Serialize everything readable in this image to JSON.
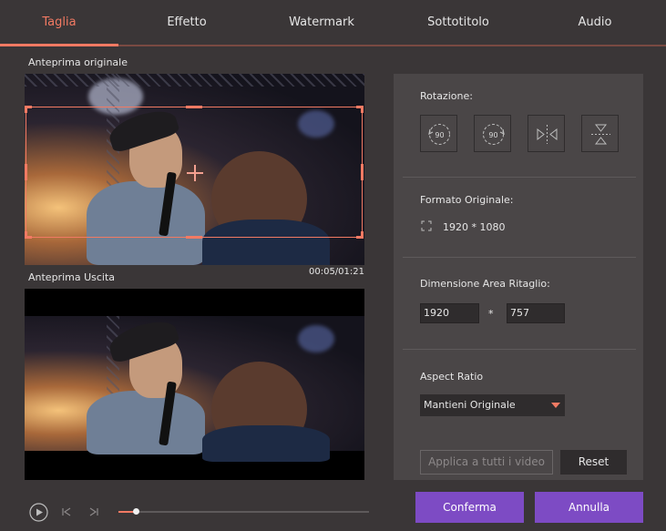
{
  "tabs": [
    {
      "label": "Taglia",
      "active": true
    },
    {
      "label": "Effetto",
      "active": false
    },
    {
      "label": "Watermark",
      "active": false
    },
    {
      "label": "Sottotitolo",
      "active": false
    },
    {
      "label": "Audio",
      "active": false
    }
  ],
  "preview": {
    "original_label": "Anteprima originale",
    "output_label": "Anteprima Uscita",
    "timecode": "00:05/01:21"
  },
  "panel": {
    "rotation_label": "Rotazione:",
    "rotate_left_text": "90",
    "rotate_right_text": "90",
    "original_format_label": "Formato Originale:",
    "original_format_value": "1920 * 1080",
    "crop_size_label": "Dimensione Area Ritaglio:",
    "crop_width": "1920",
    "crop_separator": "*",
    "crop_height": "757",
    "aspect_ratio_label": "Aspect Ratio",
    "aspect_ratio_value": "Mantieni Originale",
    "apply_all_label": "Applica a tutti i video",
    "reset_label": "Reset"
  },
  "actions": {
    "confirm_label": "Conferma",
    "cancel_label": "Annulla"
  },
  "player": {
    "progress": 0.07
  },
  "icons": {
    "rotate_left": "rotate-left-icon",
    "rotate_right": "rotate-right-icon",
    "flip_horizontal": "flip-horizontal-icon",
    "flip_vertical": "flip-vertical-icon",
    "resolution": "resolution-icon",
    "play": "play-icon",
    "prev": "previous-frame-icon",
    "next": "next-frame-icon"
  },
  "colors": {
    "accent": "#f27a63",
    "button_primary": "#7d4bc4",
    "background": "#3a3637",
    "panel": "#4a4647"
  }
}
